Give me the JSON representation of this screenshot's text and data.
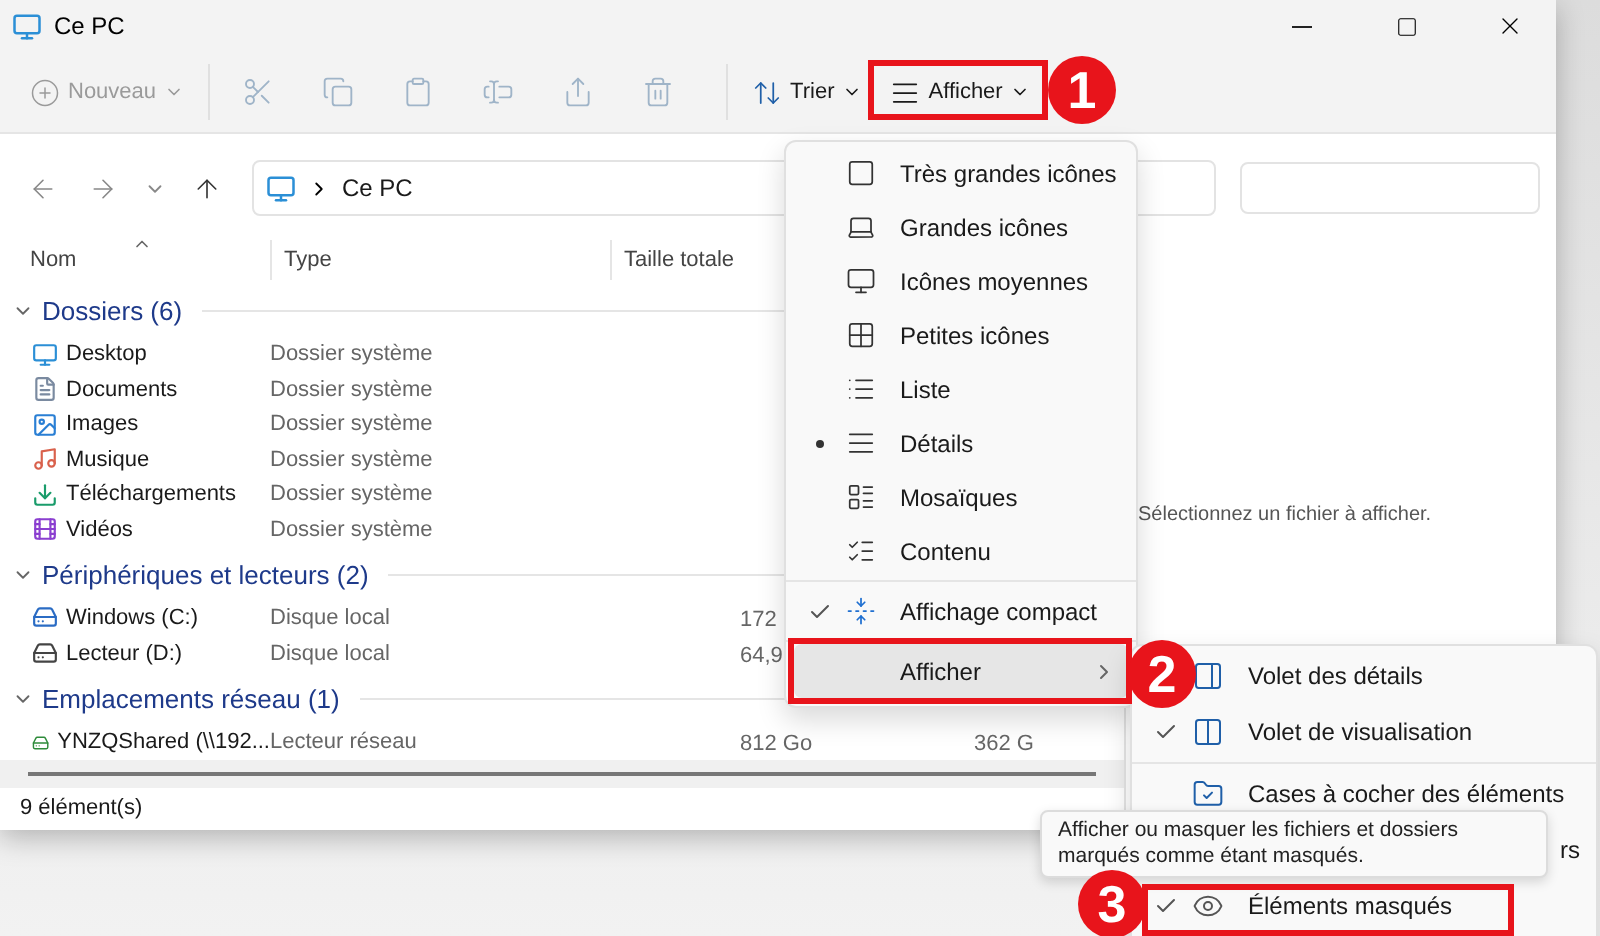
{
  "window": {
    "title": "Ce PC"
  },
  "toolbar": {
    "new_button": {
      "label": "Nouveau",
      "disabled": true
    },
    "sort_button": {
      "label": "Trier"
    },
    "view_button": {
      "label": "Afficher"
    }
  },
  "address": {
    "path": "Ce PC"
  },
  "columns": [
    "Nom",
    "Type",
    "Taille totale"
  ],
  "groups": [
    {
      "title": "Dossiers (6)",
      "expanded": true,
      "items": [
        {
          "name": "Desktop",
          "type": "Dossier système",
          "kind": "desktop"
        },
        {
          "name": "Documents",
          "type": "Dossier système",
          "kind": "documents"
        },
        {
          "name": "Images",
          "type": "Dossier système",
          "kind": "images"
        },
        {
          "name": "Musique",
          "type": "Dossier système",
          "kind": "music"
        },
        {
          "name": "Téléchargements",
          "type": "Dossier système",
          "kind": "downloads"
        },
        {
          "name": "Vidéos",
          "type": "Dossier système",
          "kind": "videos"
        }
      ]
    },
    {
      "title": "Périphériques et lecteurs (2)",
      "expanded": true,
      "items": [
        {
          "name": "Windows (C:)",
          "type": "Disque local",
          "size": "172",
          "kind": "system-drive"
        },
        {
          "name": "Lecteur (D:)",
          "type": "Disque local",
          "size": "64,9",
          "kind": "drive"
        }
      ]
    },
    {
      "title": "Emplacements réseau (1)",
      "expanded": true,
      "items": [
        {
          "name": "YNZQShared (\\\\192...",
          "type": "Lecteur réseau",
          "size": "812 Go",
          "free": "362 G",
          "kind": "network-drive"
        }
      ]
    }
  ],
  "preview": {
    "message": "Sélectionnez un fichier à afficher."
  },
  "status_bar": {
    "count": "9 élément(s)"
  },
  "view_menu": {
    "items": [
      {
        "label": "Très grandes icônes",
        "kind": "xl",
        "selected": false
      },
      {
        "label": "Grandes icônes",
        "kind": "large",
        "selected": false
      },
      {
        "label": "Icônes moyennes",
        "kind": "medium",
        "selected": false
      },
      {
        "label": "Petites icônes",
        "kind": "small",
        "selected": false
      },
      {
        "label": "Liste",
        "kind": "list",
        "selected": false
      },
      {
        "label": "Détails",
        "kind": "details",
        "selected": true
      },
      {
        "label": "Mosaïques",
        "kind": "tiles",
        "selected": false
      },
      {
        "label": "Contenu",
        "kind": "content",
        "selected": false
      }
    ],
    "compact": {
      "label": "Affichage compact",
      "checked": true
    },
    "submenu_item": {
      "label": "Afficher",
      "highlighted": true
    }
  },
  "show_submenu": {
    "items": [
      {
        "label": "Volet des détails",
        "kind": "details-pane"
      },
      {
        "label": "Volet de visualisation",
        "kind": "preview-pane",
        "checked": true
      },
      {
        "label": "Cases à cocher des éléments",
        "kind": "checkboxes",
        "divider_before": true
      },
      {
        "label": "rs",
        "kind": "covered"
      },
      {
        "label": "Éléments masqués",
        "kind": "hidden",
        "checked": true
      }
    ]
  },
  "tooltip": {
    "text": "Afficher ou masquer les fichiers et dossiers marqués comme étant masqués."
  },
  "annotations": [
    {
      "label": "1"
    },
    {
      "label": "2"
    },
    {
      "label": "3"
    }
  ]
}
